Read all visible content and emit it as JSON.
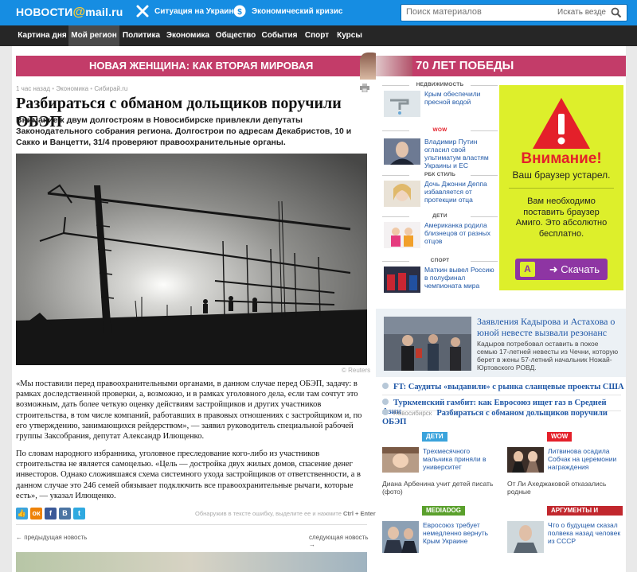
{
  "header": {
    "logo_main": "НОВОСТИ",
    "logo_at": "@",
    "logo_domain": "mail.ru",
    "links": [
      {
        "label": "Ситуация на Украине",
        "icon": "ukraine-cross-icon"
      },
      {
        "label": "Экономический кризис",
        "icon": "economy-icon"
      }
    ],
    "search": {
      "placeholder": "Поиск материалов",
      "scope_label": "Искать везде",
      "icon": "search-icon"
    }
  },
  "nav": [
    "Картина дня",
    "Мой регион",
    "Политика",
    "Экономика",
    "Общество",
    "События",
    "Спорт",
    "Курсы"
  ],
  "nav_active": "Мой регион",
  "colors": {
    "brand_blue": "#168de2",
    "nav_bg": "#262626",
    "banner_pink": "#c33c69",
    "link_blue": "#1f57a6",
    "ad_green": "#ddef2b",
    "ad_red": "#e4202a",
    "ad_purple": "#8e35a3"
  },
  "banner_left": "НОВАЯ ЖЕНЩИНА: КАК ВТОРАЯ МИРОВАЯ ПОВЛИЯЛА НА МОДУ",
  "banner_right": "70 ЛЕТ ПОБЕДЫ",
  "article": {
    "breadcrumb": [
      "1 час назад",
      "Экономика",
      "Сибирай.ru"
    ],
    "title": "Разбираться с обманом дольщиков поручили ОБЭП",
    "lead": "Внимание к двум долгостроям в Новосибирске привлекли депутаты Законодательного собрания региона. Долгострои по адресам Декабристов, 10 и Сакко и Ванцетти, 31/4 проверяют правоохранительные органы.",
    "photo_credit": "© Reuters",
    "paragraphs": [
      "«Мы поставили перед правоохранительными органами, в данном случае перед ОБЭП, задачу: в рамках доследственной проверки, а, возможно, и в рамках уголовного дела, если там сочтут это возможным, дать более четкую оценку действиям застройщиков и других участников строительства, в том числе компаний, работавших в правовых отношениях с застройщиком и, по его утверждению, занимающихся рейдерством», — заявил руководитель специальной рабочей группы Заксобрания, депутат Александр Илющенко.",
      "По словам народного избранника, уголовное преследование кого-либо из участников строительства не является самоцелью. «Цель — достройка двух жилых домов, спасение денег инвесторов. Однако сложившаяся схема системного ухода застройщиков от ответственности, а в данном случае это 246 семей обязывает подключить все правоохранительные рычаги, которые есть», — указал Илющенко."
    ],
    "share": [
      {
        "label": "👍",
        "color": "#3aa3dc",
        "icon": "like-icon"
      },
      {
        "label": "ок",
        "color": "#ee8208",
        "icon": "odnoklassniki-icon"
      },
      {
        "label": "f",
        "color": "#3b5998",
        "icon": "facebook-icon"
      },
      {
        "label": "В",
        "color": "#4c75a3",
        "icon": "vkontakte-icon"
      },
      {
        "label": "t",
        "color": "#2fa9e0",
        "icon": "twitter-icon"
      }
    ],
    "error_hint": "Обнаружив в тексте ошибку, выделите ее и нажмите",
    "error_keys": "Ctrl + Enter",
    "prev": "предыдущая новость",
    "next": "следующая новость"
  },
  "sidebar": {
    "mini": [
      {
        "category": "НЕДВИЖИМОСТЬ",
        "text": "Крым обеспечили пресной водой"
      },
      {
        "category": "WOW",
        "text": "Владимир Путин огласил свой ультиматум властям Украины и ЕС"
      },
      {
        "category": "РБК СТИЛЬ",
        "text": "Дочь Джонни Деппа избавляется от протекции отца"
      },
      {
        "category": "ДЕТИ",
        "text": "Американка родила близнецов от разных отцов"
      },
      {
        "category": "СПОРТ",
        "text": "Маткин вывел Россию в полуфинал чемпионата мира"
      }
    ],
    "ad": {
      "heading": "Внимание!",
      "subheading": "Ваш браузер устарел.",
      "body": "Вам необходимо поставить браузер Амиго. Это абсолютно бесплатно.",
      "button": "Скачать",
      "button_letter": "A"
    },
    "feature": {
      "title": "Заявления Кадырова и Астахова о юной невесте вызвали резонанс",
      "desc": "Кадыров потребовал оставить в покое семью 17-летней невесты из Чечни, которую берет в жены 57-летний начальник Ножай-Юртовского РОВД."
    },
    "lines": [
      {
        "prefix": "",
        "text": "FT: Саудиты «выдавили» с рынка сланцевые проекты США"
      },
      {
        "prefix": "",
        "text": "Туркменский гамбит: как Евросоюз ищет газ в Средней Азии"
      },
      {
        "prefix": "Новосибирск",
        "text": "Разбираться с обманом дольщиков поручили ОБЭП"
      }
    ],
    "blocks": [
      {
        "tag": "ДЕТИ",
        "tag_color": "#3aa3dc",
        "text": "Трехмесячного мальчика приняли в университет",
        "text2": "Диана Арбенина учит детей писать (фото)"
      },
      {
        "tag": "WOW",
        "tag_color": "#e4202a",
        "text": "Литвинова осадила Собчак на церемонии награждения",
        "text2": "От Ли Аxeджаковой отказались родные"
      },
      {
        "tag": "MEDIADOG",
        "tag_color": "#5aa02c",
        "text": "Евросоюз требует немедленно вернуть Крым Украине",
        "text2": ""
      },
      {
        "tag": "АРГУМЕНТЫ И ФАКТЫ",
        "tag_color": "#c1272d",
        "text": "Что о будущем сказал полвека назад человек из СССР",
        "text2": ""
      }
    ]
  }
}
